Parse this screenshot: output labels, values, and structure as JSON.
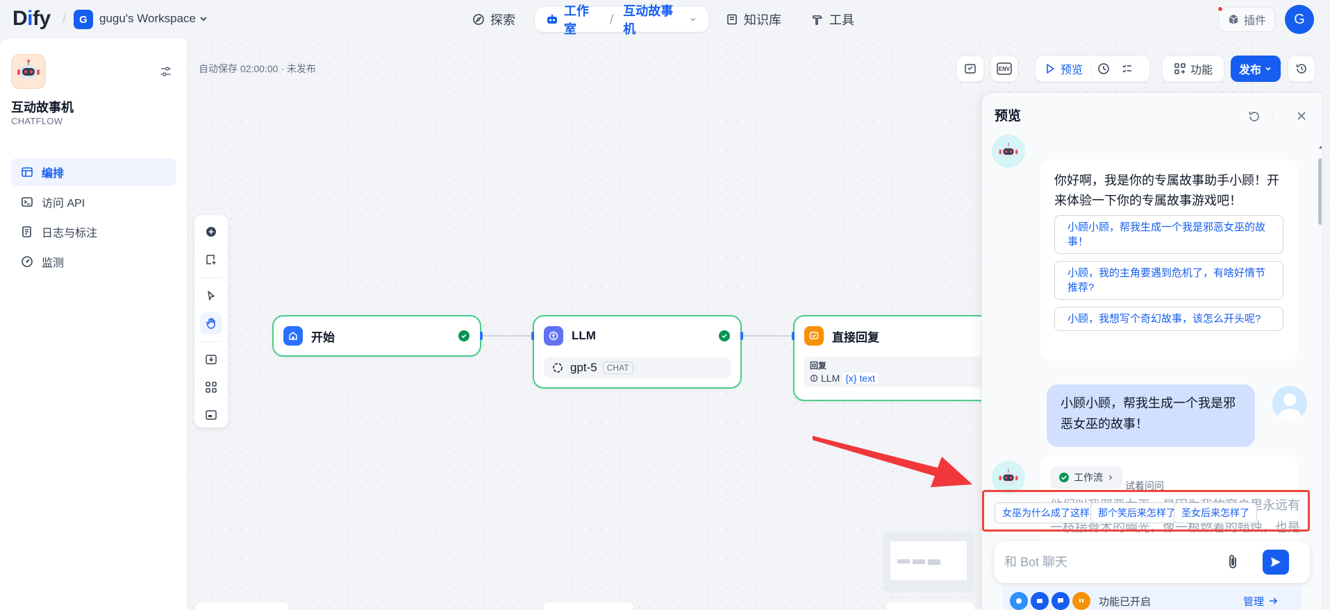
{
  "topbar": {
    "logo": "Dify",
    "workspace_initial": "G",
    "workspace_name": "gugu's Workspace",
    "nav": {
      "explore": "探索",
      "studio": "工作室",
      "app_name": "互动故事机",
      "knowledge": "知识库",
      "tools": "工具"
    },
    "plugins": "插件",
    "user_initial": "G"
  },
  "sidebar": {
    "app_name": "互动故事机",
    "app_type": "CHATFLOW",
    "items": [
      {
        "label": "编排",
        "active": true
      },
      {
        "label": "访问 API"
      },
      {
        "label": "日志与标注"
      },
      {
        "label": "监测"
      }
    ]
  },
  "canvas": {
    "autosave": "自动保存 02:00:00 · 未发布",
    "env_label": "ENV",
    "preview_btn": "预览",
    "features_btn": "功能",
    "publish_btn": "发布",
    "nodes": {
      "start": {
        "title": "开始"
      },
      "llm": {
        "title": "LLM",
        "model": "gpt-5",
        "mode": "CHAT"
      },
      "answer": {
        "title": "直接回复",
        "section": "回复",
        "var_source": "LLM",
        "var_name": "text"
      }
    }
  },
  "preview": {
    "title": "预览",
    "greeting": "你好啊，我是你的专属故事助手小顾！开来体验一下你的专属故事游戏吧！",
    "opening_questions": [
      "小顾小顾，帮我生成一个我是邪恶女巫的故事！",
      "小顾，我的主角要遇到危机了，有啥好情节推荐?",
      "小顾，我想写个奇幻故事，该怎么开头呢?"
    ],
    "user_message": "小顾小顾，帮我生成一个我是邪恶女巫的故事！",
    "workflow_tag": "工作流",
    "try_ask": "试着问问",
    "faded_reply": "他们叫我邪恶女巫，是因为我的窗户里永远有一枝接骨木的幽光，像一根燃着的蜡烛，也是因为我从不向他",
    "suggested": [
      "女巫为什么成了这样",
      "那个笑后来怎样了",
      "圣女后来怎样了"
    ],
    "input_placeholder": "和 Bot 聊天",
    "features_enabled": "功能已开启",
    "manage": "管理"
  },
  "colors": {
    "accent": "#155eef",
    "node_border": "#47cd89",
    "success": "#079455",
    "highlight": "#f04438"
  }
}
